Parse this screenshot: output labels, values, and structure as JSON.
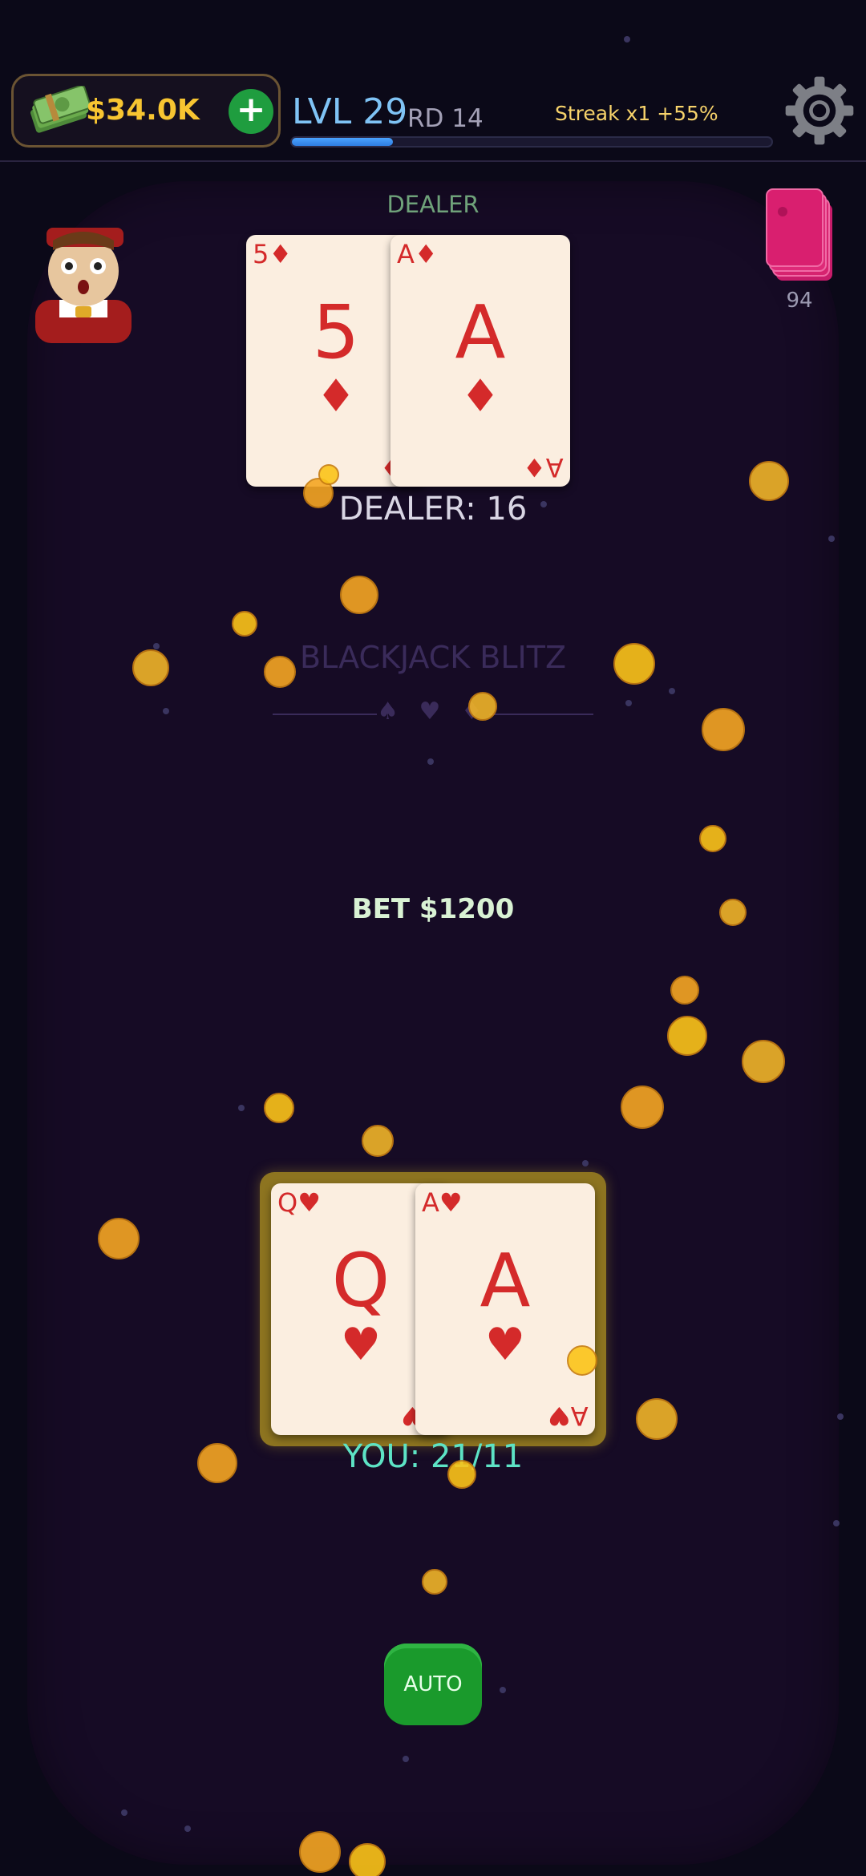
{
  "hud": {
    "money": "$34.0K",
    "add_label": "+",
    "level": "LVL 29",
    "round": "RD 14",
    "streak": "Streak x1 +55%",
    "xp_progress": 0.21,
    "icons": {
      "cash": "cash-icon",
      "settings": "gear-icon"
    }
  },
  "dealer": {
    "label": "DEALER",
    "score": "DEALER: 16",
    "deck_count": "94",
    "cards": [
      {
        "rank": "5",
        "suit": "♦",
        "corner": "5♦"
      },
      {
        "rank": "A",
        "suit": "♦",
        "corner": "A♦"
      }
    ]
  },
  "table": {
    "title": "BLACKJACK BLITZ",
    "suits": "♠ ♥ ♦",
    "bet": "BET $1200"
  },
  "player": {
    "score": "YOU: 21/11",
    "cards": [
      {
        "rank": "Q",
        "suit": "♥",
        "corner": "Q♥"
      },
      {
        "rank": "A",
        "suit": "♥",
        "corner": "A♥"
      }
    ]
  },
  "controls": {
    "auto_label": "AUTO"
  },
  "colors": {
    "background": "#0b0918",
    "table": "#160b25",
    "money": "#f7c531",
    "card_red": "#d42a2a",
    "auto_button": "#1a9a2c"
  }
}
